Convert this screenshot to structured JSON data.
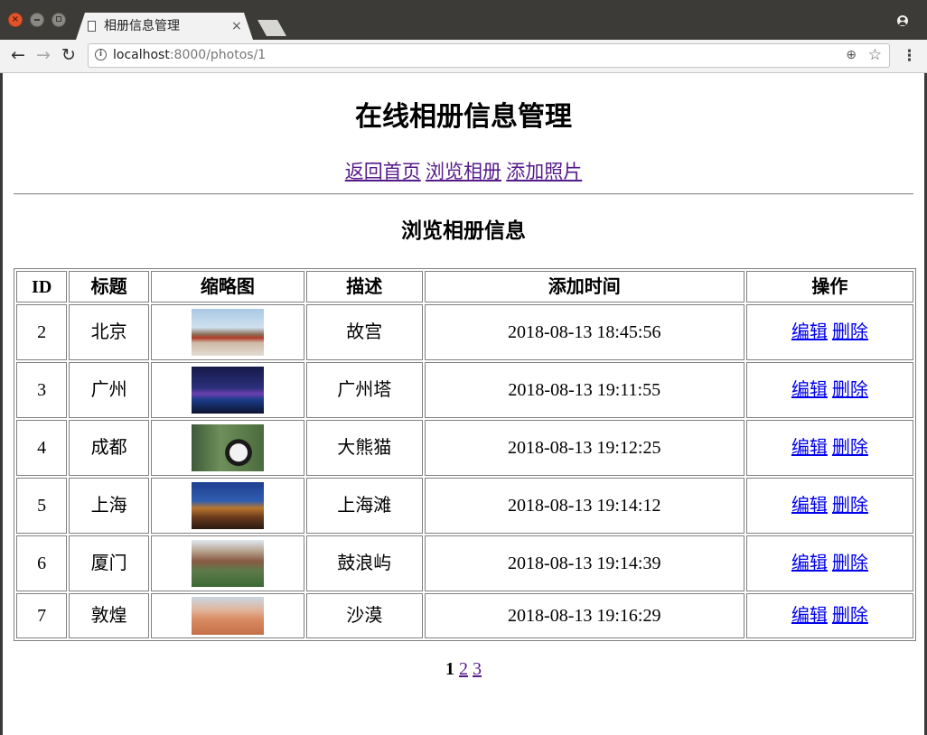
{
  "browser": {
    "tab_title": "相册信息管理",
    "tab_close": "×",
    "url_host": "localhost",
    "url_path": ":8000/photos/1",
    "icons": [
      "close-window-icon",
      "minimize-window-icon",
      "maximize-window-icon",
      "page-icon",
      "profile-icon",
      "back-arrow-icon",
      "forward-arrow-icon",
      "reload-icon",
      "info-icon",
      "zoom-icon",
      "star-icon",
      "menu-icon"
    ]
  },
  "page": {
    "title": "在线相册信息管理",
    "nav_links": [
      "返回首页",
      "浏览相册",
      "添加照片"
    ],
    "section_title": "浏览相册信息"
  },
  "table": {
    "headers": [
      "ID",
      "标题",
      "缩略图",
      "描述",
      "添加时间",
      "操作"
    ],
    "rows": [
      {
        "id": "2",
        "title": "北京",
        "description": "故宫",
        "added": "2018-08-13 18:45:56",
        "edit": "编辑",
        "delete": "删除"
      },
      {
        "id": "3",
        "title": "广州",
        "description": "广州塔",
        "added": "2018-08-13 19:11:55",
        "edit": "编辑",
        "delete": "删除"
      },
      {
        "id": "4",
        "title": "成都",
        "description": "大熊猫",
        "added": "2018-08-13 19:12:25",
        "edit": "编辑",
        "delete": "删除"
      },
      {
        "id": "5",
        "title": "上海",
        "description": "上海滩",
        "added": "2018-08-13 19:14:12",
        "edit": "编辑",
        "delete": "删除"
      },
      {
        "id": "6",
        "title": "厦门",
        "description": "鼓浪屿",
        "added": "2018-08-13 19:14:39",
        "edit": "编辑",
        "delete": "删除"
      },
      {
        "id": "7",
        "title": "敦煌",
        "description": "沙漠",
        "added": "2018-08-13 19:16:29",
        "edit": "编辑",
        "delete": "删除"
      }
    ]
  },
  "pagination": {
    "current": "1",
    "pages": [
      "2",
      "3"
    ]
  },
  "colors": {
    "link": "#0000ee",
    "visited_link": "#551a8b"
  }
}
